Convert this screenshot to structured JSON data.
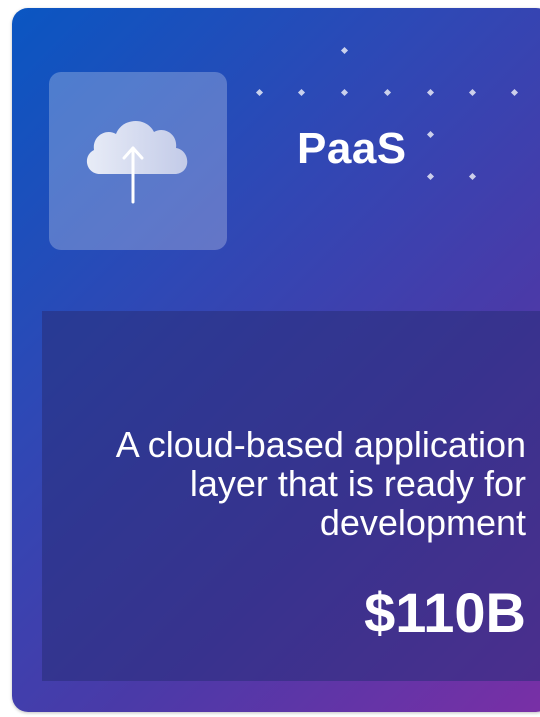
{
  "card": {
    "title": "PaaS",
    "description": "A cloud-based application layer that is ready for development",
    "value": "$110B",
    "icon": "cloud-upload-icon"
  },
  "colors": {
    "gradient_start": "#0a56c2",
    "gradient_end": "#7a2fa6",
    "text": "#ffffff"
  }
}
